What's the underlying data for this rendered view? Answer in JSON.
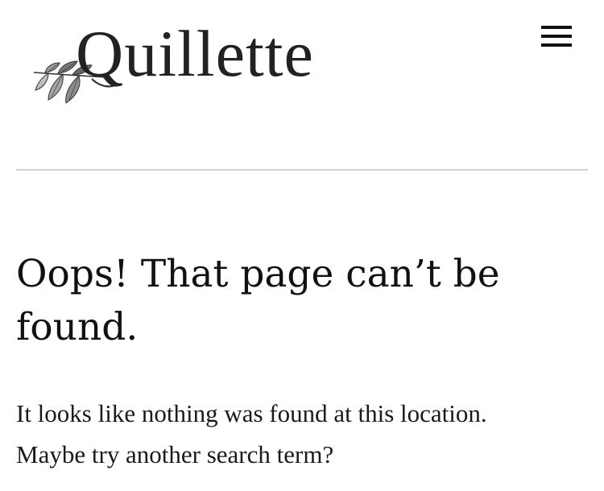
{
  "header": {
    "logo_text": "Quillette",
    "menu_icon": "hamburger-menu-icon",
    "logo_icon": "leaf-sprig-icon"
  },
  "main": {
    "title": "Oops! That page can’t be found.",
    "message": "It looks like nothing was found at this location. Maybe try another search term?"
  },
  "colors": {
    "text": "#111111",
    "divider": "#d4d4d4",
    "background": "#ffffff"
  }
}
